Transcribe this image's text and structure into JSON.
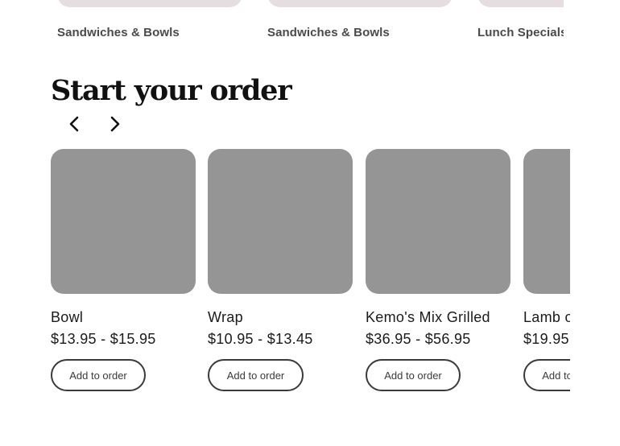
{
  "categories": {
    "items": [
      {
        "label": "Sandwiches & Bowls"
      },
      {
        "label": "Sandwiches & Bowls"
      },
      {
        "label": "Lunch Specials"
      }
    ]
  },
  "order_section": {
    "title": "Start your order",
    "prev_icon": "chevron-left-icon",
    "next_icon": "chevron-right-icon",
    "products": [
      {
        "name": "Bowl",
        "price": "$13.95 - $15.95",
        "button_label": "Add to order"
      },
      {
        "name": "Wrap",
        "price": "$10.95 - $13.45",
        "button_label": "Add to order"
      },
      {
        "name": "Kemo's Mix Grilled",
        "price": "$36.95 - $56.95",
        "button_label": "Add to order"
      },
      {
        "name": "Lamb over Rice",
        "price": "$19.95",
        "button_label": "Add to order"
      }
    ]
  },
  "colors": {
    "category_image": "#e6dde0",
    "product_image": "#959595",
    "button_border": "#3a3a3a"
  }
}
